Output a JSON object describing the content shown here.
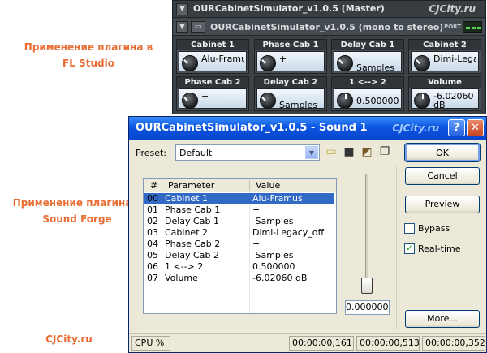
{
  "captions": {
    "fl": [
      "Применение плагина в",
      "FL Studio"
    ],
    "sf": [
      "Применение плагина в",
      "Sound Forge"
    ],
    "site": "CJCity.ru"
  },
  "fl_window": {
    "title": "OURCabinetSimulator_v1.0.5 (Master)",
    "watermark": "CJCity.ru",
    "subtitle": "OURCabinetSimulator_v1.0.5 (mono to stereo)",
    "port_label": "PORT",
    "knobs": [
      {
        "label": "Cabinet 1",
        "value": "Alu-Framus",
        "valign": "top"
      },
      {
        "label": "Phase Cab 1",
        "value": "+",
        "valign": "top"
      },
      {
        "label": "Delay Cab 1",
        "value": "Samples",
        "valign": "bottom"
      },
      {
        "label": "Cabinet 2",
        "value": "Dimi-Legacy",
        "valign": "top"
      },
      {
        "label": "Phase Cab 2",
        "value": "+",
        "valign": "top"
      },
      {
        "label": "Delay Cab 2",
        "value": "Samples",
        "valign": "bottom"
      },
      {
        "label": "1 <--> 2",
        "value": "0.500000",
        "valign": "mid"
      },
      {
        "label": "Volume",
        "value": "-6.02060\ndB",
        "valign": "top"
      }
    ]
  },
  "sf_window": {
    "title": "OURCabinetSimulator_v1.0.5 - Sound 1",
    "watermark": "CJCity.ru",
    "help_glyph": "?",
    "close_glyph": "✕",
    "preset_label": "Preset:",
    "preset_value": "Default",
    "buttons": {
      "ok": "OK",
      "cancel": "Cancel",
      "preview": "Preview",
      "more": "More..."
    },
    "bypass_label": "Bypass",
    "bypass_checked": false,
    "realtime_label": "Real-time",
    "realtime_checked": true,
    "table": {
      "headers": [
        "#",
        "Parameter",
        "Value"
      ],
      "rows": [
        {
          "num": "00",
          "param": "Cabinet 1",
          "value": "Alu-Framus",
          "selected": true
        },
        {
          "num": "01",
          "param": "Phase Cab 1",
          "value": "+"
        },
        {
          "num": "02",
          "param": "Delay Cab 1",
          "value": " Samples"
        },
        {
          "num": "03",
          "param": "Cabinet 2",
          "value": "Dimi-Legacy_off"
        },
        {
          "num": "04",
          "param": "Phase Cab 2",
          "value": "+"
        },
        {
          "num": "05",
          "param": "Delay Cab 2",
          "value": " Samples"
        },
        {
          "num": "06",
          "param": "1 <--> 2",
          "value": "0.500000"
        },
        {
          "num": "07",
          "param": "Volume",
          "value": "-6.02060 dB"
        }
      ]
    },
    "slider_value": "0.000000",
    "slider_level": 0,
    "status": {
      "cpu": "CPU %",
      "t1": "00:00:00,161",
      "t2": "00:00:00,513",
      "t3": "00:00:00,352"
    }
  }
}
